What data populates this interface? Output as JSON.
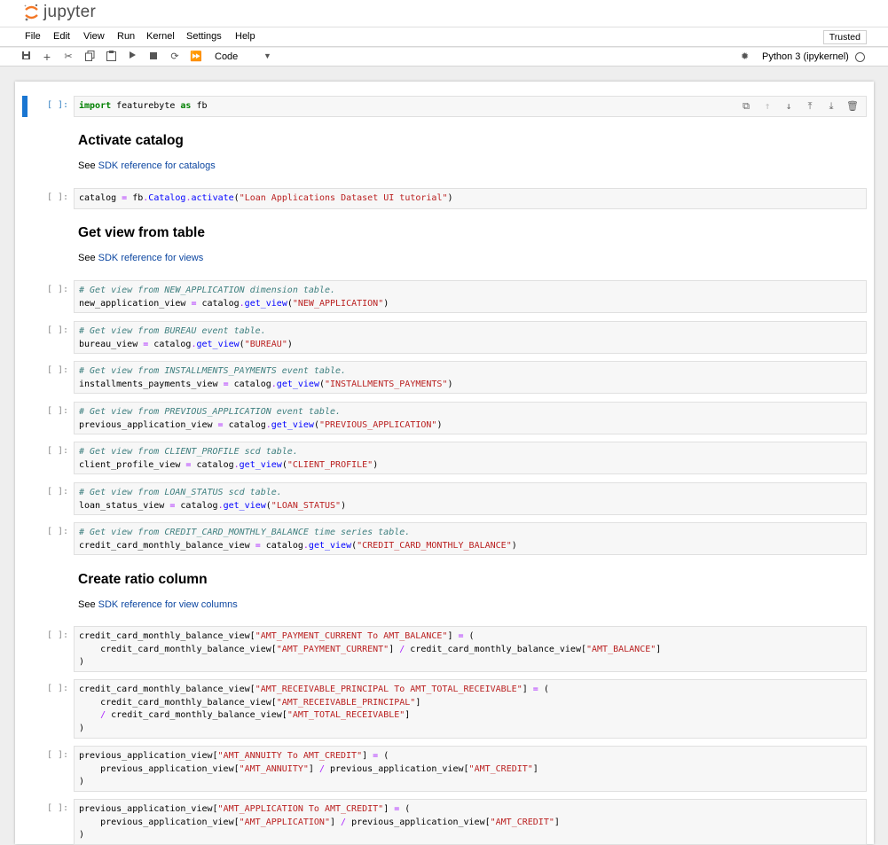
{
  "app": {
    "logo_text": "jupyter",
    "trusted_label": "Trusted"
  },
  "menu": [
    "File",
    "Edit",
    "View",
    "Run",
    "Kernel",
    "Settings",
    "Help"
  ],
  "toolbar": {
    "cell_type": "Code",
    "kernel": "Python 3 (ipykernel)"
  },
  "prompt_text": "[ ]:",
  "cells": [
    {
      "kind": "code",
      "lines": [
        [
          [
            "k",
            "import"
          ],
          [
            "n",
            " featurebyte "
          ],
          [
            "k",
            "as"
          ],
          [
            "n",
            " fb"
          ]
        ]
      ]
    },
    {
      "kind": "markdown",
      "heading": "Activate catalog",
      "prefix": "See ",
      "link": "SDK reference for catalogs"
    },
    {
      "kind": "code",
      "lines": [
        [
          [
            "n",
            "catalog "
          ],
          [
            "o",
            "="
          ],
          [
            "n",
            " fb"
          ],
          [
            "o",
            "."
          ],
          [
            "f",
            "Catalog"
          ],
          [
            "o",
            "."
          ],
          [
            "f",
            "activate"
          ],
          [
            "n",
            "("
          ],
          [
            "s",
            "\"Loan Applications Dataset UI tutorial\""
          ],
          [
            "n",
            ")"
          ]
        ]
      ]
    },
    {
      "kind": "markdown",
      "heading": "Get view from table",
      "prefix": "See ",
      "link": "SDK reference for views"
    },
    {
      "kind": "code",
      "lines": [
        [
          [
            "c",
            "# Get view from NEW_APPLICATION dimension table."
          ]
        ],
        [
          [
            "n",
            "new_application_view "
          ],
          [
            "o",
            "="
          ],
          [
            "n",
            " catalog"
          ],
          [
            "o",
            "."
          ],
          [
            "f",
            "get_view"
          ],
          [
            "n",
            "("
          ],
          [
            "s",
            "\"NEW_APPLICATION\""
          ],
          [
            "n",
            ")"
          ]
        ]
      ]
    },
    {
      "kind": "code",
      "lines": [
        [
          [
            "c",
            "# Get view from BUREAU event table."
          ]
        ],
        [
          [
            "n",
            "bureau_view "
          ],
          [
            "o",
            "="
          ],
          [
            "n",
            " catalog"
          ],
          [
            "o",
            "."
          ],
          [
            "f",
            "get_view"
          ],
          [
            "n",
            "("
          ],
          [
            "s",
            "\"BUREAU\""
          ],
          [
            "n",
            ")"
          ]
        ]
      ]
    },
    {
      "kind": "code",
      "lines": [
        [
          [
            "c",
            "# Get view from INSTALLMENTS_PAYMENTS event table."
          ]
        ],
        [
          [
            "n",
            "installments_payments_view "
          ],
          [
            "o",
            "="
          ],
          [
            "n",
            " catalog"
          ],
          [
            "o",
            "."
          ],
          [
            "f",
            "get_view"
          ],
          [
            "n",
            "("
          ],
          [
            "s",
            "\"INSTALLMENTS_PAYMENTS\""
          ],
          [
            "n",
            ")"
          ]
        ]
      ]
    },
    {
      "kind": "code",
      "lines": [
        [
          [
            "c",
            "# Get view from PREVIOUS_APPLICATION event table."
          ]
        ],
        [
          [
            "n",
            "previous_application_view "
          ],
          [
            "o",
            "="
          ],
          [
            "n",
            " catalog"
          ],
          [
            "o",
            "."
          ],
          [
            "f",
            "get_view"
          ],
          [
            "n",
            "("
          ],
          [
            "s",
            "\"PREVIOUS_APPLICATION\""
          ],
          [
            "n",
            ")"
          ]
        ]
      ]
    },
    {
      "kind": "code",
      "lines": [
        [
          [
            "c",
            "# Get view from CLIENT_PROFILE scd table."
          ]
        ],
        [
          [
            "n",
            "client_profile_view "
          ],
          [
            "o",
            "="
          ],
          [
            "n",
            " catalog"
          ],
          [
            "o",
            "."
          ],
          [
            "f",
            "get_view"
          ],
          [
            "n",
            "("
          ],
          [
            "s",
            "\"CLIENT_PROFILE\""
          ],
          [
            "n",
            ")"
          ]
        ]
      ]
    },
    {
      "kind": "code",
      "lines": [
        [
          [
            "c",
            "# Get view from LOAN_STATUS scd table."
          ]
        ],
        [
          [
            "n",
            "loan_status_view "
          ],
          [
            "o",
            "="
          ],
          [
            "n",
            " catalog"
          ],
          [
            "o",
            "."
          ],
          [
            "f",
            "get_view"
          ],
          [
            "n",
            "("
          ],
          [
            "s",
            "\"LOAN_STATUS\""
          ],
          [
            "n",
            ")"
          ]
        ]
      ]
    },
    {
      "kind": "code",
      "lines": [
        [
          [
            "c",
            "# Get view from CREDIT_CARD_MONTHLY_BALANCE time series table."
          ]
        ],
        [
          [
            "n",
            "credit_card_monthly_balance_view "
          ],
          [
            "o",
            "="
          ],
          [
            "n",
            " catalog"
          ],
          [
            "o",
            "."
          ],
          [
            "f",
            "get_view"
          ],
          [
            "n",
            "("
          ],
          [
            "s",
            "\"CREDIT_CARD_MONTHLY_BALANCE\""
          ],
          [
            "n",
            ")"
          ]
        ]
      ]
    },
    {
      "kind": "markdown",
      "heading": "Create ratio column",
      "prefix": "See ",
      "link": "SDK reference for view columns"
    },
    {
      "kind": "code",
      "lines": [
        [
          [
            "n",
            "credit_card_monthly_balance_view["
          ],
          [
            "s",
            "\"AMT_PAYMENT_CURRENT To AMT_BALANCE\""
          ],
          [
            "n",
            "] "
          ],
          [
            "o",
            "="
          ],
          [
            "n",
            " ("
          ]
        ],
        [
          [
            "n",
            "    credit_card_monthly_balance_view["
          ],
          [
            "s",
            "\"AMT_PAYMENT_CURRENT\""
          ],
          [
            "n",
            "] "
          ],
          [
            "o",
            "/"
          ],
          [
            "n",
            " credit_card_monthly_balance_view["
          ],
          [
            "s",
            "\"AMT_BALANCE\""
          ],
          [
            "n",
            "]"
          ]
        ],
        [
          [
            "n",
            ")"
          ]
        ]
      ]
    },
    {
      "kind": "code",
      "lines": [
        [
          [
            "n",
            "credit_card_monthly_balance_view["
          ],
          [
            "s",
            "\"AMT_RECEIVABLE_PRINCIPAL To AMT_TOTAL_RECEIVABLE\""
          ],
          [
            "n",
            "] "
          ],
          [
            "o",
            "="
          ],
          [
            "n",
            " ("
          ]
        ],
        [
          [
            "n",
            "    credit_card_monthly_balance_view["
          ],
          [
            "s",
            "\"AMT_RECEIVABLE_PRINCIPAL\""
          ],
          [
            "n",
            "]"
          ]
        ],
        [
          [
            "n",
            "    "
          ],
          [
            "o",
            "/"
          ],
          [
            "n",
            " credit_card_monthly_balance_view["
          ],
          [
            "s",
            "\"AMT_TOTAL_RECEIVABLE\""
          ],
          [
            "n",
            "]"
          ]
        ],
        [
          [
            "n",
            ")"
          ]
        ]
      ]
    },
    {
      "kind": "code",
      "lines": [
        [
          [
            "n",
            "previous_application_view["
          ],
          [
            "s",
            "\"AMT_ANNUITY To AMT_CREDIT\""
          ],
          [
            "n",
            "] "
          ],
          [
            "o",
            "="
          ],
          [
            "n",
            " ("
          ]
        ],
        [
          [
            "n",
            "    previous_application_view["
          ],
          [
            "s",
            "\"AMT_ANNUITY\""
          ],
          [
            "n",
            "] "
          ],
          [
            "o",
            "/"
          ],
          [
            "n",
            " previous_application_view["
          ],
          [
            "s",
            "\"AMT_CREDIT\""
          ],
          [
            "n",
            "]"
          ]
        ],
        [
          [
            "n",
            ")"
          ]
        ]
      ]
    },
    {
      "kind": "code",
      "lines": [
        [
          [
            "n",
            "previous_application_view["
          ],
          [
            "s",
            "\"AMT_APPLICATION To AMT_CREDIT\""
          ],
          [
            "n",
            "] "
          ],
          [
            "o",
            "="
          ],
          [
            "n",
            " ("
          ]
        ],
        [
          [
            "n",
            "    previous_application_view["
          ],
          [
            "s",
            "\"AMT_APPLICATION\""
          ],
          [
            "n",
            "] "
          ],
          [
            "o",
            "/"
          ],
          [
            "n",
            " previous_application_view["
          ],
          [
            "s",
            "\"AMT_CREDIT\""
          ],
          [
            "n",
            "]"
          ]
        ],
        [
          [
            "n",
            ")"
          ]
        ]
      ]
    }
  ]
}
